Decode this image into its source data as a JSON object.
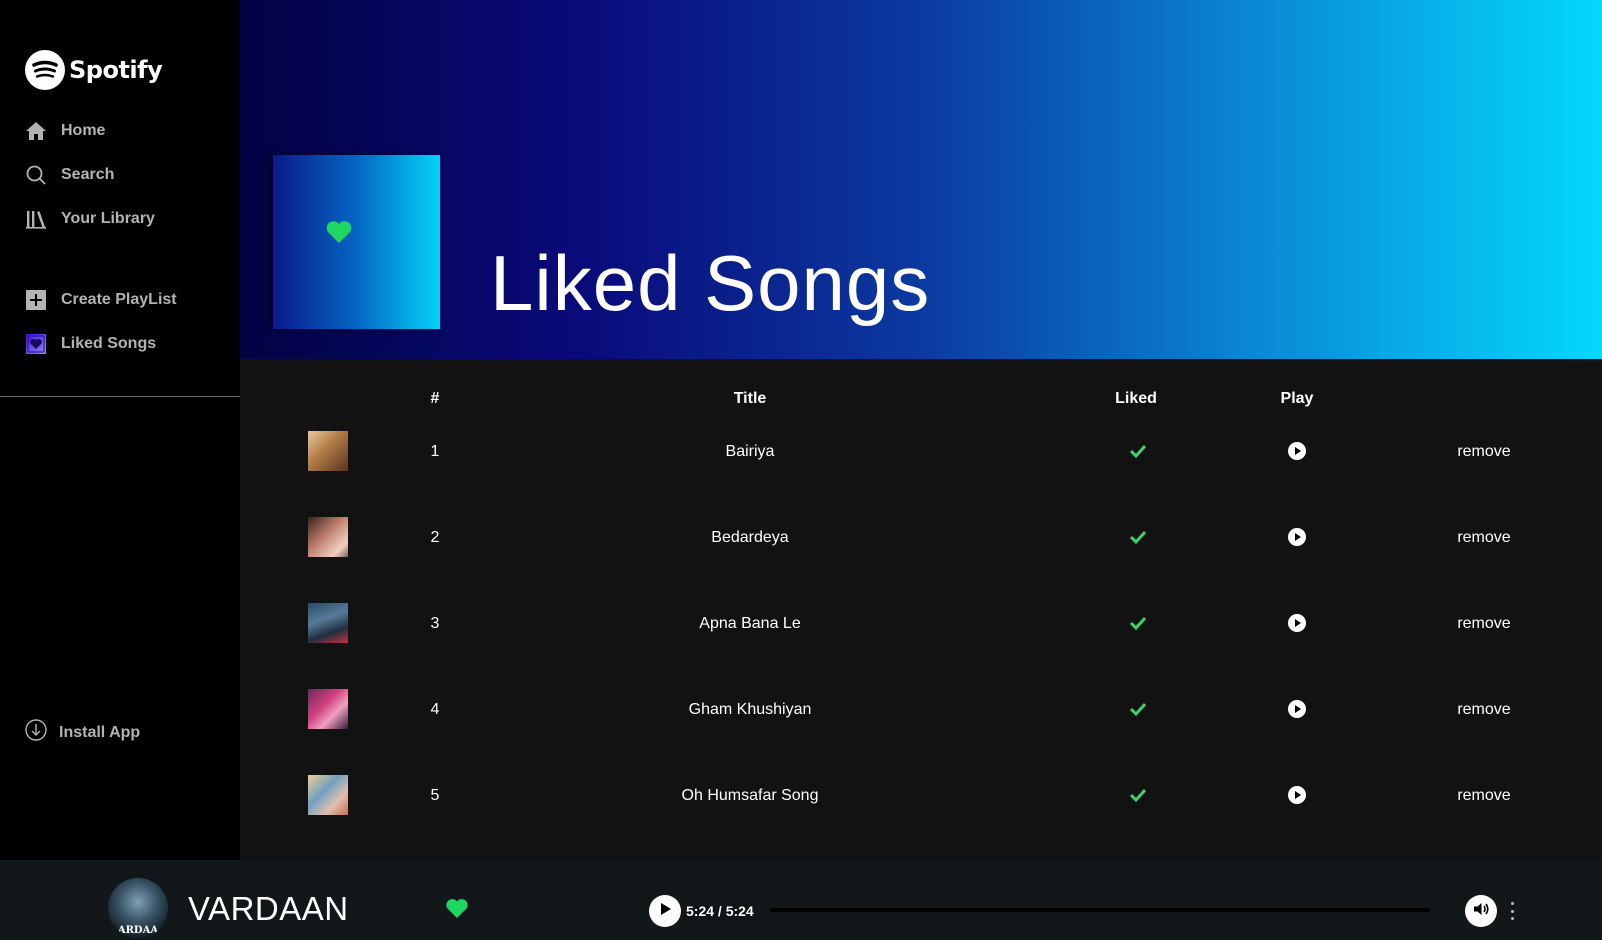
{
  "brand": {
    "name": "Spotify",
    "logo_icon": "spotify-logo-icon"
  },
  "sidebar": {
    "nav": [
      {
        "label": "Home",
        "icon": "home-icon"
      },
      {
        "label": "Search",
        "icon": "search-icon"
      },
      {
        "label": "Your Library",
        "icon": "library-icon"
      }
    ],
    "actions": [
      {
        "label": "Create PlayList",
        "icon": "plus-square-icon"
      },
      {
        "label": "Liked Songs",
        "icon": "liked-songs-icon"
      }
    ],
    "install": {
      "label": "Install App",
      "icon": "download-circle-icon"
    }
  },
  "header": {
    "title": "Liked Songs",
    "gradient": [
      "#020344",
      "#0a0a7a",
      "#0b3aa0",
      "#0a8ad4",
      "#03d8fd"
    ],
    "cover_icon": "heart-icon"
  },
  "table": {
    "columns": {
      "number": "#",
      "title": "Title",
      "liked": "Liked",
      "play": "Play"
    },
    "rows": [
      {
        "number": "1",
        "title": "Bairiya",
        "liked_icon": "check-icon",
        "play_icon": "play-circle-icon",
        "remove": "remove"
      },
      {
        "number": "2",
        "title": "Bedardeya",
        "liked_icon": "check-icon",
        "play_icon": "play-circle-icon",
        "remove": "remove"
      },
      {
        "number": "3",
        "title": "Apna Bana Le",
        "liked_icon": "check-icon",
        "play_icon": "play-circle-icon",
        "remove": "remove"
      },
      {
        "number": "4",
        "title": "Gham Khushiyan",
        "liked_icon": "check-icon",
        "play_icon": "play-circle-icon",
        "remove": "remove"
      },
      {
        "number": "5",
        "title": "Oh Humsafar Song",
        "liked_icon": "check-icon",
        "play_icon": "play-circle-icon",
        "remove": "remove"
      }
    ]
  },
  "player": {
    "artist": "VARDAAN",
    "avatar_caption": "ARDAA",
    "time": "5:24 / 5:24",
    "progress": 1.0,
    "liked_icon": "heart-icon",
    "play_icon": "play-icon",
    "volume_icon": "volume-icon",
    "menu_icon": "more-vertical-icon"
  },
  "colors": {
    "accent_green": "#1ed760",
    "sidebar_bg": "#000000",
    "content_bg": "#121212",
    "player_bg": "#12181a",
    "nav_text": "#b3b3b3"
  }
}
